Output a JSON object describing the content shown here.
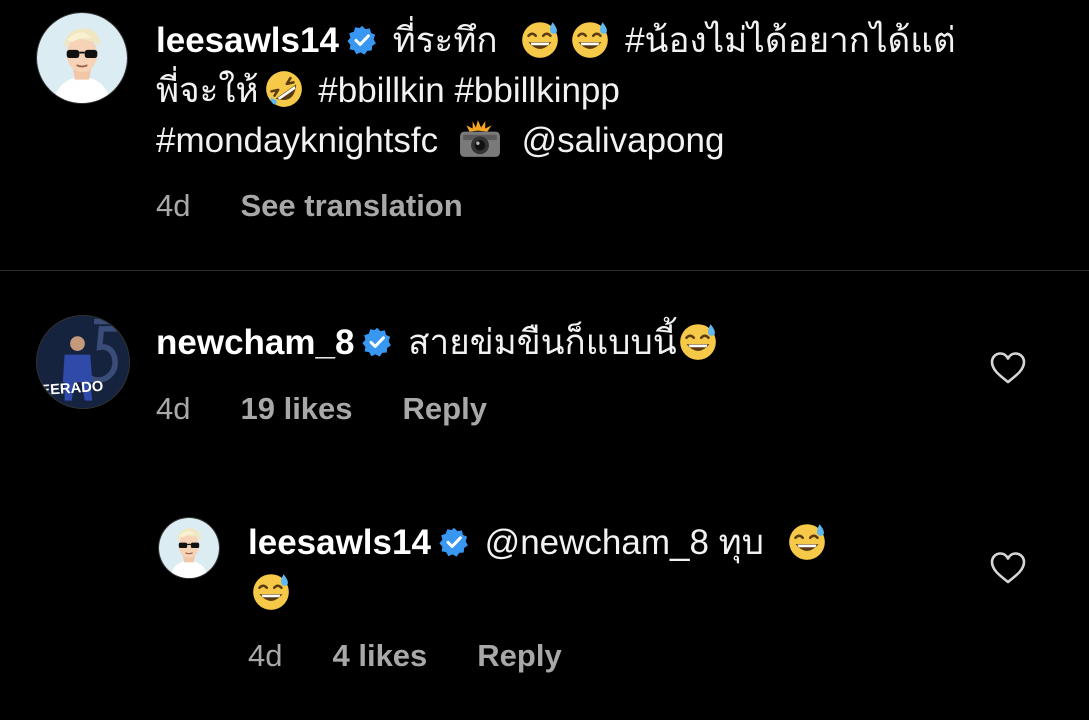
{
  "caption": {
    "username": "leesawls14",
    "line1_text": "ที่ระทึก",
    "line1_tail": "#น้องไม่ได้อยากได้แต่",
    "line2_head": "พี่จะให้",
    "line2_tags": "#bbillkin #bbillkinpp",
    "line3_tag": "#mondayknightsfc",
    "line3_mention": "@salivapong",
    "time": "4d",
    "see_translation": "See translation"
  },
  "comment": {
    "username": "newcham_8",
    "text": "สายข่มขืนก็แบบนี้",
    "avatar_text": "EERADO",
    "time": "4d",
    "likes": "19 likes",
    "reply": "Reply"
  },
  "reply_comment": {
    "username": "leesawls14",
    "text": "@newcham_8 ทุบ",
    "time": "4d",
    "likes": "4 likes",
    "reply": "Reply"
  },
  "icons": {
    "verified": "verified-badge-icon",
    "sweat_smile": "sweat-smile-emoji",
    "rofl": "rolling-on-floor-laughing-emoji",
    "camera_flash": "camera-with-flash-emoji",
    "heart": "heart-outline-icon"
  },
  "colors": {
    "background": "#000000",
    "text": "#f2f2f2",
    "meta": "#a8a8a8",
    "verified": "#3897f0",
    "divider": "#2c2c2c"
  }
}
